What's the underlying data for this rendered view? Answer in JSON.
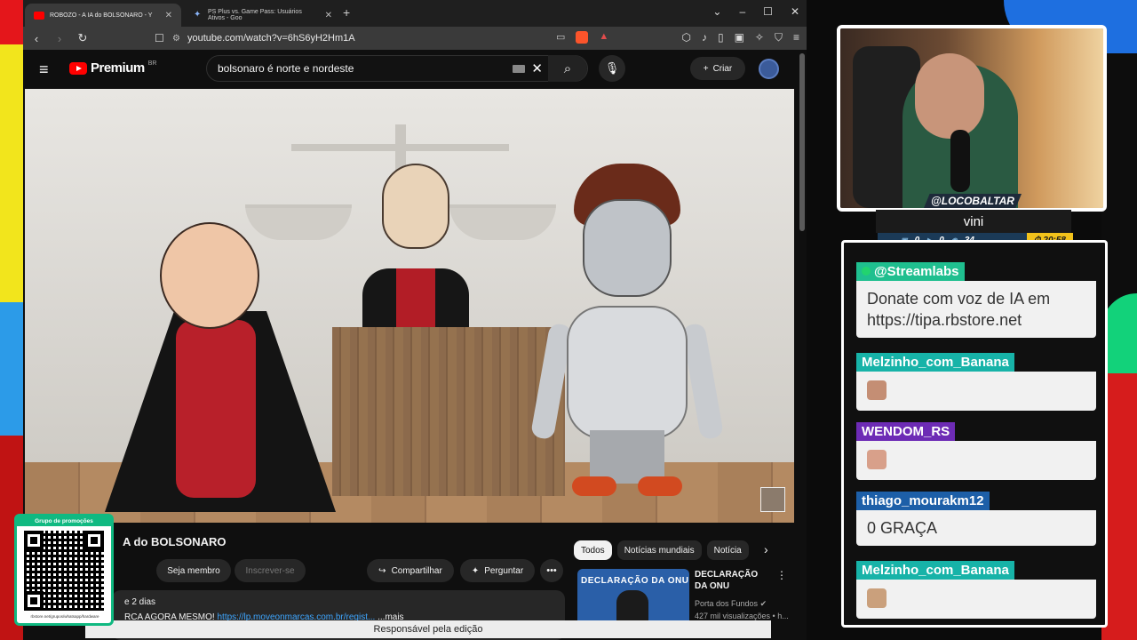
{
  "browser": {
    "tabs": [
      {
        "title": "ROBOZO - A IA do BOLSONARO - Y",
        "active": true
      },
      {
        "title": "PS Plus vs. Game Pass: Usuários Ativos - Goo",
        "active": false
      }
    ],
    "new_tab": "+",
    "window_controls": {
      "minimize": "–",
      "maximize": "☐",
      "close": "✕"
    },
    "url": "youtube.com/watch?v=6hS6yH2Hm1A",
    "status_text": "Responsável pela edição"
  },
  "youtube": {
    "logo_text": "Premium",
    "logo_region": "BR",
    "search_value": "bolsonaro é norte e nordeste",
    "create_label": "Criar",
    "video": {
      "title": "A do BOLSONARO",
      "member_label": "Seja membro",
      "subscribe_label": "Inscrever-se",
      "share_label": "Compartilhar",
      "ask_label": "Perguntar",
      "description_age": "e 2 dias",
      "description_text": "RCA AGORA MESMO!",
      "description_link": "https://lp.moveonmarcas.com.br/regist...",
      "description_more": "...mais"
    },
    "chips": [
      "Todos",
      "Notícias mundiais",
      "Notícia"
    ],
    "recommendation": {
      "thumb_text": "DECLARAÇÃO DA ONU",
      "title": "DECLARAÇÃO DA ONU",
      "channel": "Porta dos Fundos",
      "views": "427 mil visualizações • h..."
    }
  },
  "overlay": {
    "qr_caption": "Grupo de promoções",
    "qr_url": "rbstore.net/grupos/whatsapp/hardware",
    "streamer_handle": "@LOCOBALTAR",
    "streamer_subtitle": "vini",
    "stats": {
      "a": "0",
      "b": "0",
      "c": "34",
      "timer": "20:58"
    },
    "chat": [
      {
        "user": "@Streamlabs",
        "color": "#1fbf8f",
        "text": "Donate com voz de IA em https://tipa.rbstore.net",
        "emote": false
      },
      {
        "user": "Melzinho_com_Banana",
        "color": "#17b3a8",
        "text": "",
        "emote": true
      },
      {
        "user": "WENDOM_RS",
        "color": "#6d2bb5",
        "text": "",
        "emote": true
      },
      {
        "user": "thiago_mourakm12",
        "color": "#1d5fa8",
        "text": "0 GRAÇA",
        "emote": false
      },
      {
        "user": "Melzinho_com_Banana",
        "color": "#17b3a8",
        "text": "",
        "emote": true
      }
    ]
  }
}
